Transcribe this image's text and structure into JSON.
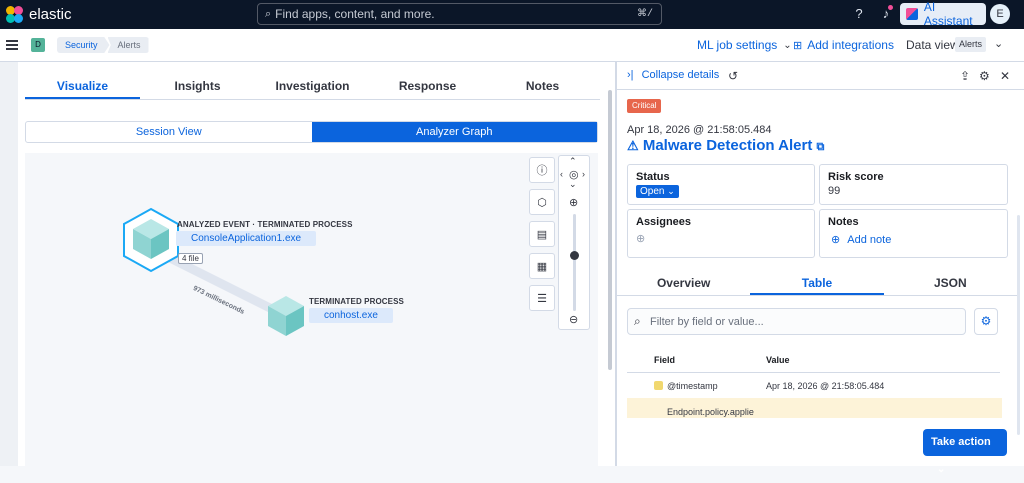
{
  "app": {
    "name": "elastic",
    "search_placeholder": "Find apps, content, and more.",
    "search_shortcut": "⌘/",
    "ai_assistant_label": "AI Assistant",
    "avatar_initial": "E"
  },
  "subbar": {
    "space_initial": "D",
    "breadcrumbs": [
      "Security",
      "Alerts"
    ],
    "ml_job_settings": "ML job settings",
    "add_integrations": "Add integrations",
    "data_view_label": "Data view",
    "data_view_value": "Alerts"
  },
  "left": {
    "tabs": [
      "Visualize",
      "Insights",
      "Investigation",
      "Response",
      "Notes"
    ],
    "active_tab": "Visualize",
    "views": [
      "Session View",
      "Analyzer Graph"
    ],
    "active_view": "Analyzer Graph",
    "graph": {
      "node1": {
        "label": "ANALYZED EVENT · TERMINATED PROCESS",
        "name": "ConsoleApplication1.exe",
        "badge": "4 file"
      },
      "edge_label": "973 milliseconds",
      "node2": {
        "label": "TERMINATED PROCESS",
        "name": "conhost.exe"
      }
    },
    "tool_icons": [
      "info-icon",
      "hexagon-icon",
      "document-icon",
      "calendar-icon",
      "list-icon"
    ]
  },
  "flyout": {
    "collapse_label": "Collapse details",
    "severity": "Critical",
    "timestamp": "Apr 18, 2026 @ 21:58:05.484",
    "title": "Malware Detection Alert",
    "status_label": "Status",
    "status_value": "Open",
    "risk_label": "Risk score",
    "risk_value": "99",
    "assignees_label": "Assignees",
    "notes_label": "Notes",
    "add_note": "Add note",
    "tabs": [
      "Overview",
      "Table",
      "JSON"
    ],
    "active_tab": "Table",
    "filter_placeholder": "Filter by field or value...",
    "columns": {
      "field": "Field",
      "value": "Value"
    },
    "rows": [
      {
        "field": "@timestamp",
        "value": "Apr 18, 2026 @ 21:58:05.484"
      },
      {
        "field": "Endpoint.policy.applie",
        "value": ""
      }
    ],
    "take_action": "Take action"
  }
}
